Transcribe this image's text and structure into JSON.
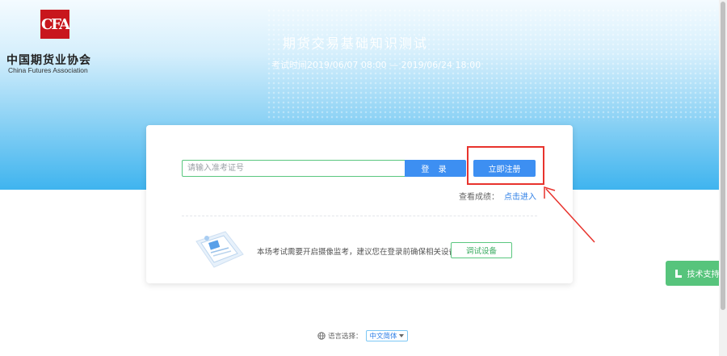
{
  "header": {
    "logo_mark": "CFA",
    "logo_name_cn": "中国期货业协会",
    "logo_name_en": "China Futures Association",
    "exam_title": "期货交易基础知识测试",
    "exam_time": "考试时间2019/06/07 08:00 — 2019/06/24 18:00"
  },
  "login": {
    "ticket_placeholder": "请输入准考证号",
    "ticket_value": "",
    "login_label": "登 录",
    "register_label": "立即注册",
    "score_prompt": "查看成绩：",
    "score_link": "点击进入"
  },
  "device": {
    "notice": "本场考试需要开启摄像监考，建议您在登录前确保相关设备可用。",
    "check_label": "调试设备"
  },
  "support": {
    "label": "技术支持"
  },
  "language": {
    "label": "语言选择：",
    "selected": "中文简体"
  },
  "colors": {
    "primary": "#3d8ff2",
    "success": "#57c47c",
    "annotation": "#e8332d",
    "brand_red": "#c8161d"
  },
  "icons": [
    "support-icon",
    "globe-icon",
    "chevron-down-icon",
    "screen-illustration-icon"
  ]
}
